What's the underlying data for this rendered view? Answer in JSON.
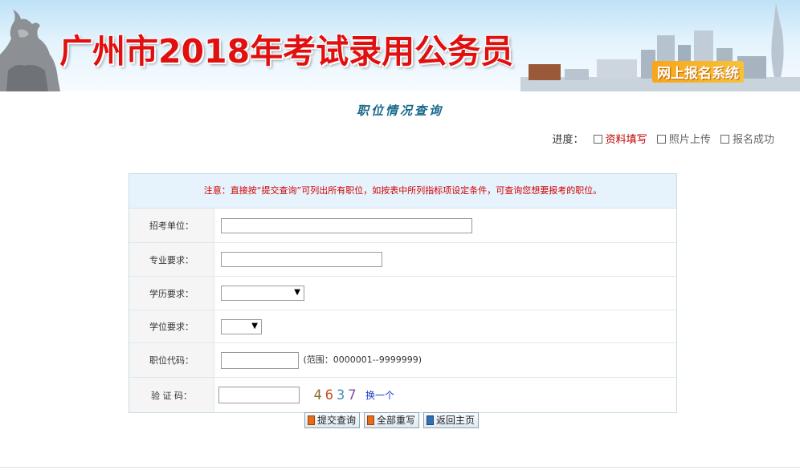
{
  "banner": {
    "title": "广州市2018年考试录用公务员",
    "system_name": "网上报名系统"
  },
  "page_title": "职位情况查询",
  "progress": {
    "label": "进度：",
    "steps": [
      {
        "label": "资料填写",
        "state": "active"
      },
      {
        "label": "照片上传",
        "state": "inactive"
      },
      {
        "label": "报名成功",
        "state": "inactive"
      }
    ]
  },
  "notice": "注意：直接按“提交查询”可列出所有职位，如按表中所列指标项设定条件，可查询您想要报考的职位。",
  "form": {
    "unit_label": "招考单位：",
    "unit_value": "",
    "major_label": "专业要求：",
    "major_value": "",
    "education_label": "学历要求：",
    "education_value": "",
    "degree_label": "学位要求：",
    "degree_value": "",
    "code_label": "职位代码：",
    "code_value": "",
    "code_hint": "(范围：0000001--9999999)",
    "captcha_label": "验 证 码：",
    "captcha_value": "",
    "captcha_chars": [
      "4",
      "6",
      "3",
      "7"
    ],
    "refresh_label": "换一个"
  },
  "buttons": {
    "submit": "提交查询",
    "reset": "全部重写",
    "home": "返回主页"
  },
  "colors": {
    "title_red": "#e01010",
    "page_title": "#17688a",
    "notice_text": "#d00000",
    "notice_bg": "#e6f3fc",
    "link_blue": "#1a3cc8"
  }
}
